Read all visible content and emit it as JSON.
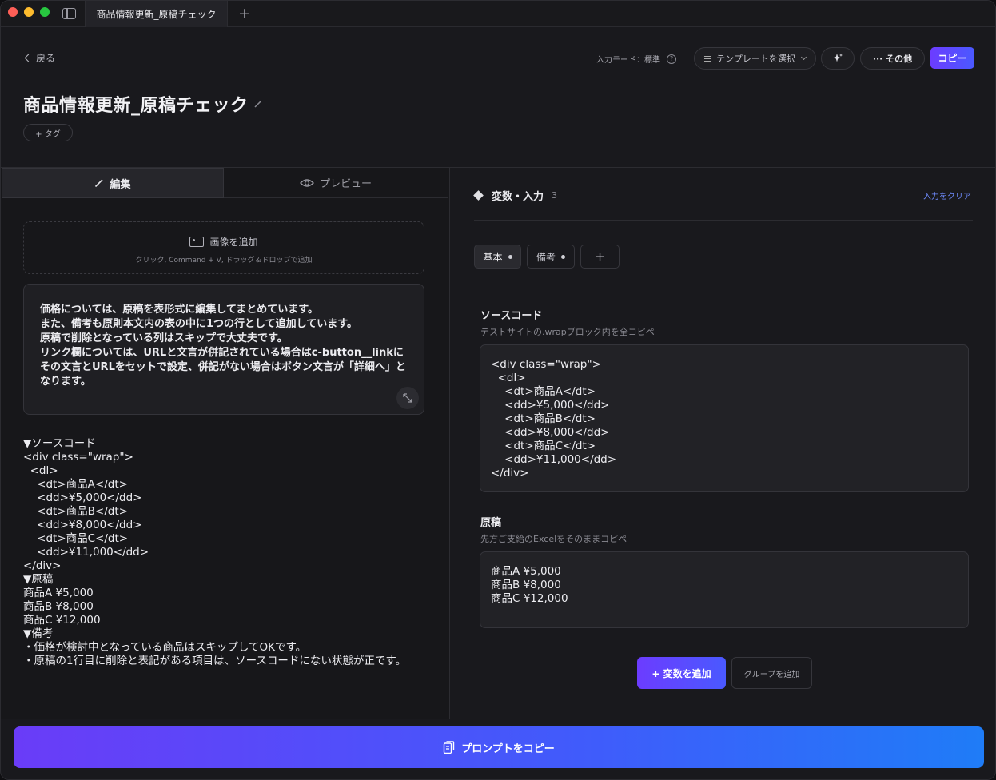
{
  "titlebar": {
    "tab_label": "商品情報更新_原稿チェック",
    "new_tab": "+"
  },
  "header": {
    "back_label": "戻る",
    "input_mode": "入力モード：標準",
    "help": "?",
    "template_select": "テンプレートを選択",
    "more_label": "··· その他",
    "copy_label": "コピー",
    "title": "商品情報更新_原稿チェック",
    "tag_label": "+ タグ"
  },
  "editor": {
    "tab_edit": "編集",
    "tab_preview": "プレビュー",
    "image_drop_title": "画像を追加",
    "image_drop_hint": "クリック, Command + V, ドラッグ＆ドロップで追加",
    "note_text": "うえますか？\n\n価格については、原稿を表形式に編集してまとめています。\nまた、備考も原則本文内の表の中に1つの行として追加しています。\n原稿で削除となっている列はスキップで大丈夫です。\nリンク欄については、URLと文言が併記されている場合はc-button__linkにその文言とURLをセットで設定、併記がない場合はボタン文言が「詳細へ」となります。",
    "body_text": "▼ソースコード\n<div class=\"wrap\">\n  <dl>\n    <dt>商品A</dt>\n    <dd>¥5,000</dd>\n    <dt>商品B</dt>\n    <dd>¥8,000</dd>\n    <dt>商品C</dt>\n    <dd>¥11,000</dd>\n</div>\n▼原稿\n商品A ¥5,000\n商品B ¥8,000\n商品C ¥12,000\n▼備考\n・価格が検討中となっている商品はスキップしてOKです。\n・原稿の1行目に削除と表記がある項目は、ソースコードにない状態が正です。"
  },
  "variables": {
    "header": "変数・入力",
    "count": "3",
    "clear_label": "入力をクリア",
    "groups": [
      {
        "label": "基本"
      },
      {
        "label": "備考"
      },
      {
        "label": "+"
      }
    ],
    "fields": [
      {
        "label": "ソースコード",
        "description": "テストサイトの.wrapブロック内を全コピペ",
        "value": "<div class=\"wrap\">\n  <dl>\n    <dt>商品A</dt>\n    <dd>¥5,000</dd>\n    <dt>商品B</dt>\n    <dd>¥8,000</dd>\n    <dt>商品C</dt>\n    <dd>¥11,000</dd>\n</div>"
      },
      {
        "label": "原稿",
        "description": "先方ご支給のExcelをそのままコピペ",
        "value": "商品A ¥5,000\n商品B ¥8,000\n商品C ¥12,000"
      }
    ],
    "add_var_label": "+ 変数を追加",
    "add_group_label": "グループを追加"
  },
  "footer": {
    "copy_prompt_label": "プロンプトをコピー"
  },
  "colors": {
    "accent_start": "#6c3cff",
    "accent_end": "#1f7cf7",
    "link": "#6f8cff"
  }
}
